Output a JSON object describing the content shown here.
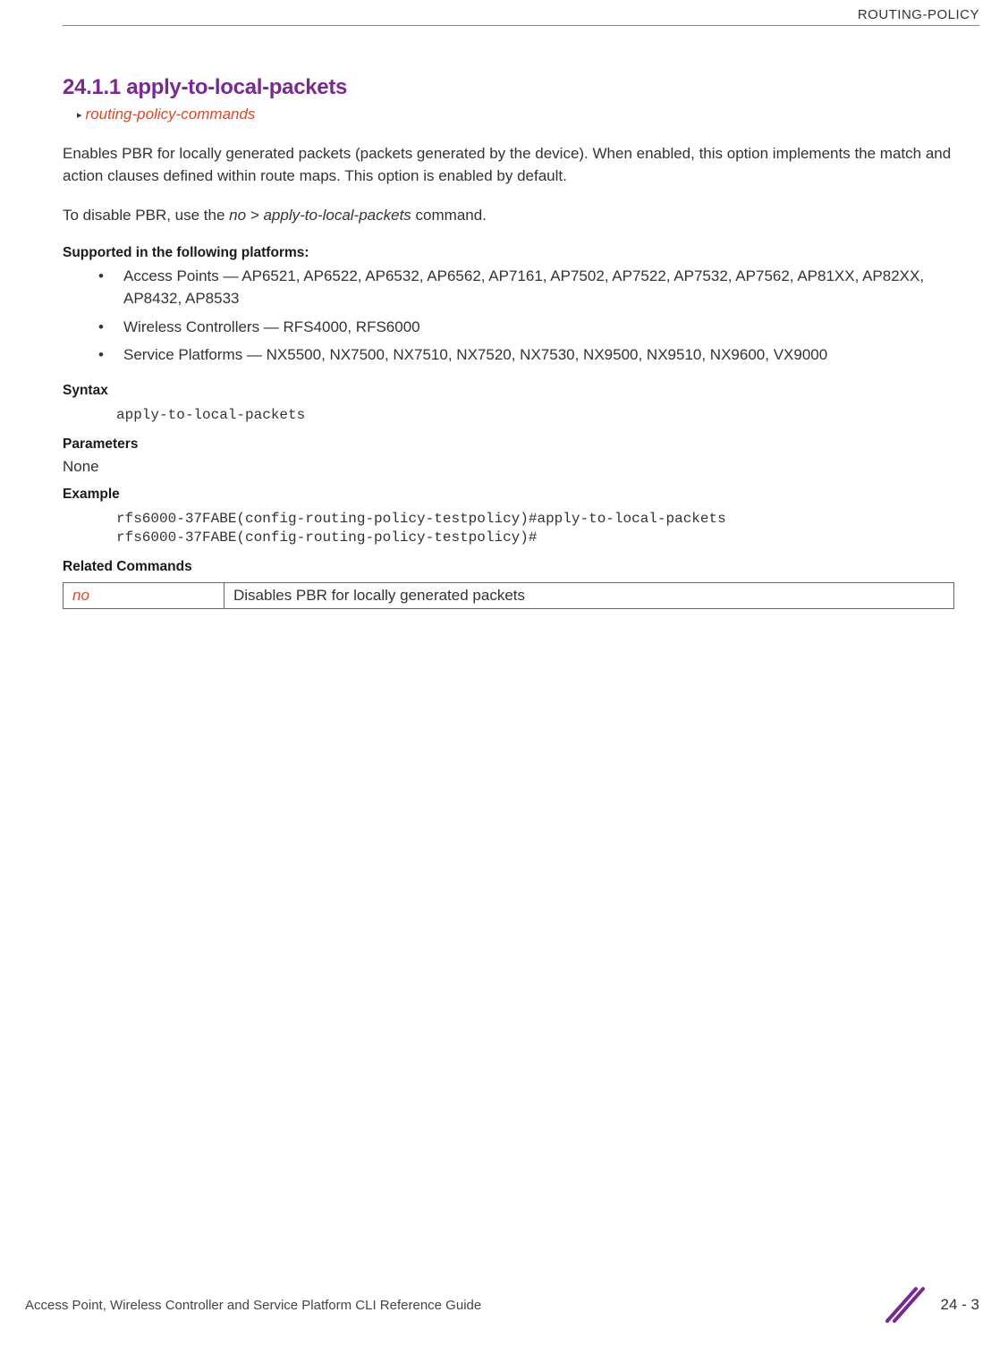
{
  "header": {
    "category": "ROUTING-POLICY"
  },
  "section": {
    "number_title": "24.1.1 apply-to-local-packets",
    "breadcrumb": "routing-policy-commands"
  },
  "paragraphs": {
    "intro": "Enables PBR for locally generated packets (packets generated by the device). When enabled, this option implements the match and action clauses defined within route maps. This option is enabled by default.",
    "disable_prefix": "To disable PBR, use the ",
    "disable_cmd": "no > apply-to-local-packets",
    "disable_suffix": " command."
  },
  "platforms": {
    "heading": "Supported in the following platforms:",
    "items": [
      "Access Points — AP6521, AP6522, AP6532, AP6562, AP7161, AP7502, AP7522, AP7532, AP7562, AP81XX, AP82XX, AP8432, AP8533",
      "Wireless Controllers — RFS4000, RFS6000",
      "Service Platforms — NX5500, NX7500, NX7510, NX7520, NX7530, NX9500, NX9510, NX9600, VX9000"
    ]
  },
  "syntax": {
    "heading": "Syntax",
    "code": "apply-to-local-packets"
  },
  "parameters": {
    "heading": "Parameters",
    "value": "None"
  },
  "example": {
    "heading": "Example",
    "code": "rfs6000-37FABE(config-routing-policy-testpolicy)#apply-to-local-packets\nrfs6000-37FABE(config-routing-policy-testpolicy)#"
  },
  "related": {
    "heading": "Related Commands",
    "rows": [
      {
        "cmd": "no",
        "desc": "Disables PBR for locally generated packets"
      }
    ]
  },
  "footer": {
    "guide": "Access Point, Wireless Controller and Service Platform CLI Reference Guide",
    "page": "24 - 3"
  }
}
